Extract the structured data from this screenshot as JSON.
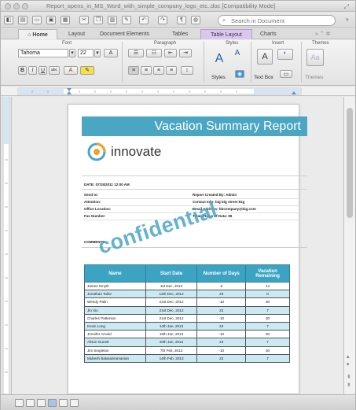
{
  "window": {
    "title": "Report_opens_in_MS_Word_with_simple_company_logo_etc..doc [Compatibility Mode]"
  },
  "toolbar": {
    "search_placeholder": "Search in Document"
  },
  "tabs": [
    {
      "label": "Home"
    },
    {
      "label": "Layout"
    },
    {
      "label": "Document Elements"
    },
    {
      "label": "Tables"
    },
    {
      "label": "Table Layout"
    },
    {
      "label": "Charts"
    }
  ],
  "ribbon": {
    "groups": [
      "Font",
      "Paragraph",
      "Styles",
      "Insert",
      "Themes"
    ],
    "font_name": "Tahoma",
    "font_size": "22",
    "styles_label": "Styles",
    "textbox_label": "Text Box",
    "themes_label": "Themes"
  },
  "document": {
    "banner_title": "Vacation Summary Report",
    "logo_text": "innovate",
    "date_line": "DATE: 07/15/2011 12:00 AM",
    "left_fields": [
      "Send to:",
      "Attention:",
      "Office Location:",
      "Fax Number:"
    ],
    "right_fields": [
      "Report Created By: Admin",
      "Contact Info: big big street 81g",
      "Email Address: bbcompany@big.com",
      "Totals Rows of Data: 96"
    ],
    "comments_label": "COMMENTS:",
    "watermark": "confidential",
    "table": {
      "headers": [
        "Name",
        "Start Date",
        "Number of Days",
        "Vacation Remaining"
      ],
      "rows": [
        [
          "James Smyth",
          "1st Dec, 2012",
          "6",
          "14"
        ],
        [
          "Jonathan Tailor",
          "12th Dec, 2012",
          "20",
          "0"
        ],
        [
          "Wendy Palin",
          "21st Dec, 2012",
          "-10",
          "30"
        ],
        [
          "Jin Xiu",
          "21st Dec, 2012",
          "22",
          "7"
        ],
        [
          "Charles Patterson",
          "21st Dec, 2012",
          "-10",
          "30"
        ],
        [
          "Kevin Long",
          "14th Jan, 2013",
          "22",
          "7"
        ],
        [
          "Jennifer Arnold",
          "15th Jan, 2013",
          "-10",
          "30"
        ],
        [
          "Alison Gunett",
          "20th Jan, 2013",
          "22",
          "7"
        ],
        [
          "Jim Singleton",
          "7th Feb, 2013",
          "-10",
          "30"
        ],
        [
          "Mukesh Balasubramanian",
          "14th Feb, 2013",
          "22",
          "7"
        ]
      ]
    }
  },
  "colors": {
    "accent": "#4aa6c3",
    "table_header": "#3ca4c2",
    "row_alt": "#cbe9f3",
    "active_tab": "#d9c8ec"
  }
}
